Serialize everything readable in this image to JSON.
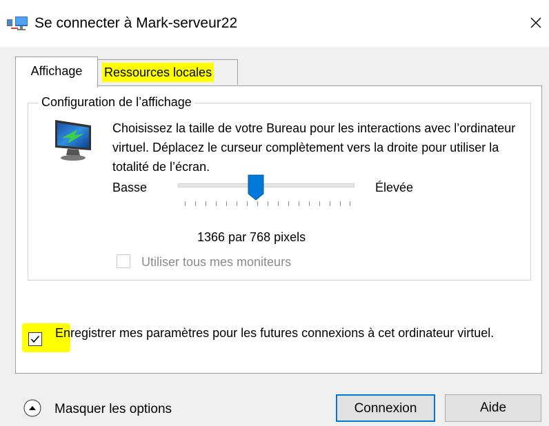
{
  "window": {
    "title": "Se connecter à Mark-serveur22",
    "icon": "remote-desktop-icon",
    "close_icon": "close-icon"
  },
  "tabs": [
    {
      "label": "Affichage",
      "active": true
    },
    {
      "label": "Ressources locales",
      "active": false,
      "highlighted": true
    }
  ],
  "display": {
    "group_title": "Configuration de l’affichage",
    "icon": "monitor-icon",
    "description": "Choisissez la taille de votre Bureau pour les interactions avec l’ordinateur virtuel. Déplacez le curseur complètement vers la droite pour utiliser la totalité de l’écran.",
    "slider": {
      "low_label": "Basse",
      "high_label": "Élevée",
      "position_fraction": 0.44
    },
    "resolution": "1366 par 768 pixels",
    "all_monitors": {
      "label": "Utiliser tous mes moniteurs",
      "checked": false,
      "enabled": false
    }
  },
  "save_settings": {
    "label": "Enregistrer mes paramètres pour les futures connexions à cet ordinateur virtuel.",
    "checked": true,
    "highlighted": true
  },
  "footer": {
    "toggle_label": "Masquer les options",
    "toggle_icon": "chevron-up-icon",
    "connect_label": "Connexion",
    "help_label": "Aide"
  },
  "colors": {
    "highlight": "#ffff00",
    "accent": "#0078d7"
  }
}
